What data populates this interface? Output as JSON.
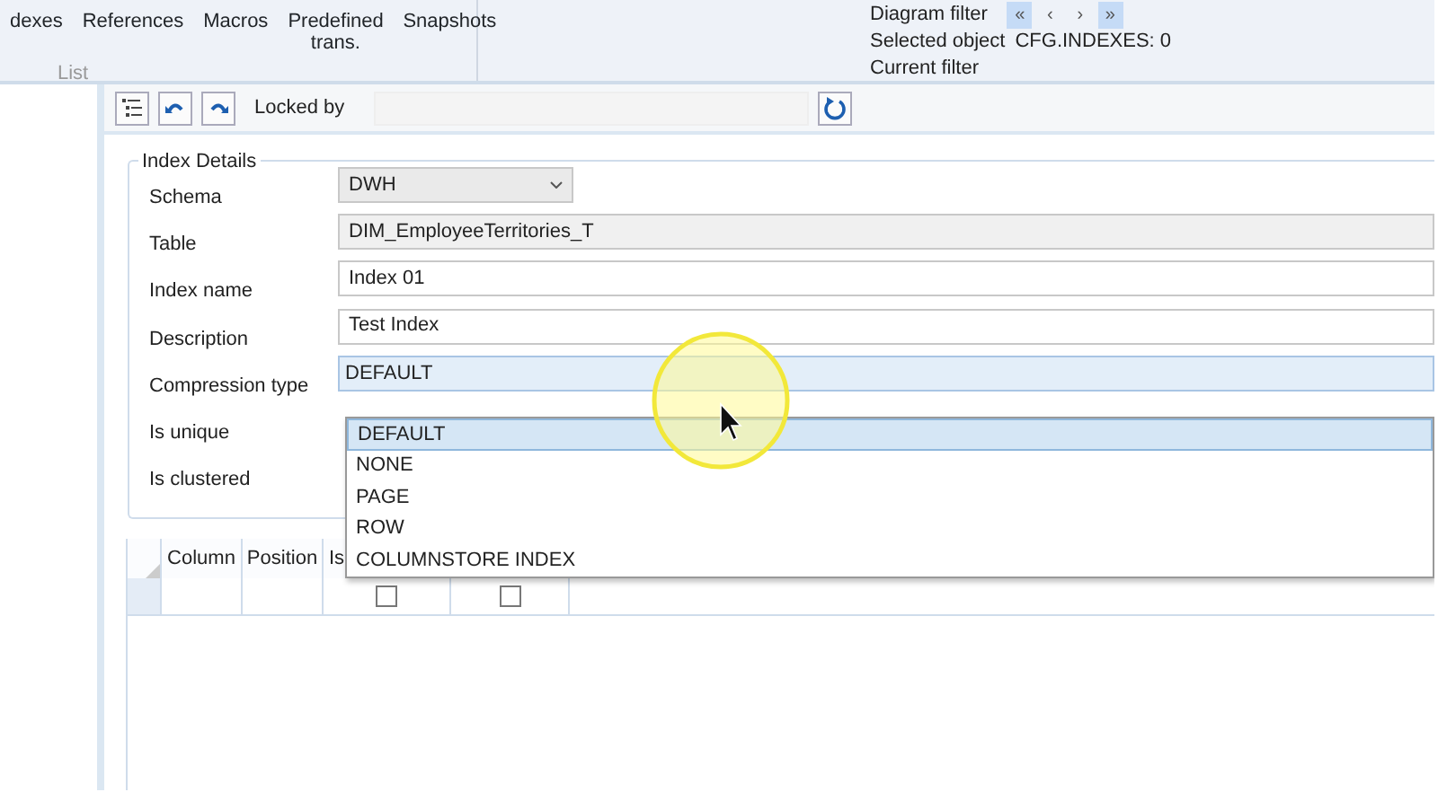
{
  "ribbon": {
    "buttons": [
      {
        "label": "dexes"
      },
      {
        "label": "References"
      },
      {
        "label": "Macros"
      },
      {
        "label": "Predefined trans."
      },
      {
        "label": "Snapshots"
      }
    ],
    "group_label": "List",
    "diagram_filter": {
      "label": "Diagram filter",
      "buttons": [
        {
          "label": "«",
          "selected": true
        },
        {
          "label": "‹",
          "selected": false
        },
        {
          "label": "›",
          "selected": false
        },
        {
          "label": "»",
          "selected": true
        }
      ]
    },
    "selected_object": {
      "label": "Selected object",
      "value": "CFG.INDEXES: 0"
    },
    "current_filter": {
      "label": "Current filter"
    }
  },
  "toolbar": {
    "locked_by_label": "Locked by"
  },
  "index_details": {
    "legend": "Index Details",
    "fields": [
      {
        "label": "Schema",
        "kind": "combo",
        "value": "DWH"
      },
      {
        "label": "Table",
        "kind": "readonly",
        "value": "DIM_EmployeeTerritories_T"
      },
      {
        "label": "Index name",
        "kind": "text",
        "value": "Index 01"
      },
      {
        "label": "Description",
        "kind": "text",
        "value": "Test Index"
      },
      {
        "label": "Compression type",
        "kind": "dropdown",
        "value": "DEFAULT"
      },
      {
        "label": "Is unique",
        "kind": "hidden"
      },
      {
        "label": "Is clustered",
        "kind": "hidden"
      }
    ],
    "dropdown_options": [
      {
        "label": "DEFAULT",
        "selected": true
      },
      {
        "label": "NONE",
        "selected": false
      },
      {
        "label": "PAGE",
        "selected": false
      },
      {
        "label": "ROW",
        "selected": false
      },
      {
        "label": "COLUMNSTORE INDEX",
        "selected": false
      }
    ]
  },
  "grid": {
    "columns": [
      "Column",
      "Position",
      "Is"
    ],
    "rows": [
      {
        "column": "",
        "position": "",
        "checks": [
          false,
          false
        ]
      }
    ]
  }
}
